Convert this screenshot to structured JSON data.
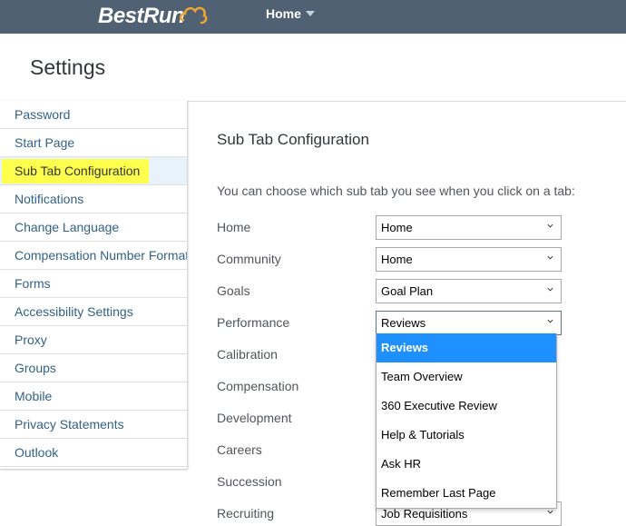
{
  "header": {
    "logo_text": "BestRun",
    "home_label": "Home"
  },
  "page": {
    "title": "Settings"
  },
  "sidebar": {
    "items": [
      {
        "label": "Password"
      },
      {
        "label": "Start Page"
      },
      {
        "label": "Sub Tab Configuration",
        "selected": true
      },
      {
        "label": "Notifications"
      },
      {
        "label": "Change Language"
      },
      {
        "label": "Compensation Number Format"
      },
      {
        "label": "Forms"
      },
      {
        "label": "Accessibility Settings"
      },
      {
        "label": "Proxy"
      },
      {
        "label": "Groups"
      },
      {
        "label": "Mobile"
      },
      {
        "label": "Privacy Statements"
      },
      {
        "label": "Outlook"
      }
    ]
  },
  "main": {
    "section_title": "Sub Tab Configuration",
    "intro": "You can choose which sub tab you see when you click on a tab:",
    "rows": [
      {
        "label": "Home",
        "value": "Home"
      },
      {
        "label": "Community",
        "value": "Home"
      },
      {
        "label": "Goals",
        "value": "Goal Plan"
      },
      {
        "label": "Performance",
        "value": "Reviews"
      },
      {
        "label": "Calibration"
      },
      {
        "label": "Compensation"
      },
      {
        "label": "Development"
      },
      {
        "label": "Careers"
      },
      {
        "label": "Succession"
      },
      {
        "label": "Recruiting",
        "value": "Job Requisitions"
      }
    ],
    "performance_dropdown": {
      "options": [
        "Reviews",
        "Team Overview",
        "360 Executive Review",
        "Help & Tutorials",
        "Ask HR",
        "Remember Last Page"
      ],
      "highlighted": "Reviews"
    }
  },
  "colors": {
    "topbar": "#4f6172",
    "link": "#346187",
    "highlight": "#ffff4d",
    "dropdown_active": "#1e90ff"
  }
}
